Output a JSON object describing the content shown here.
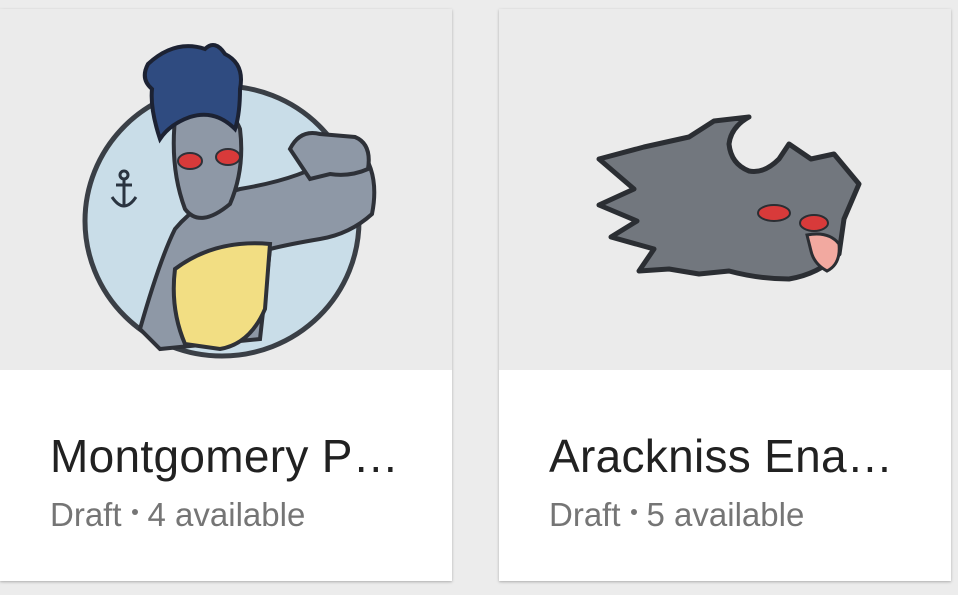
{
  "products": [
    {
      "title": "Montgomery P…",
      "status": "Draft",
      "availability": "4 available",
      "image_icon": "pin-image"
    },
    {
      "title": "Arackniss Ena…",
      "status": "Draft",
      "availability": "5 available",
      "image_icon": "pin-image"
    }
  ],
  "colors": {
    "background": "#ececec",
    "card": "#ffffff",
    "title_text": "#212121",
    "meta_text": "#757575"
  }
}
